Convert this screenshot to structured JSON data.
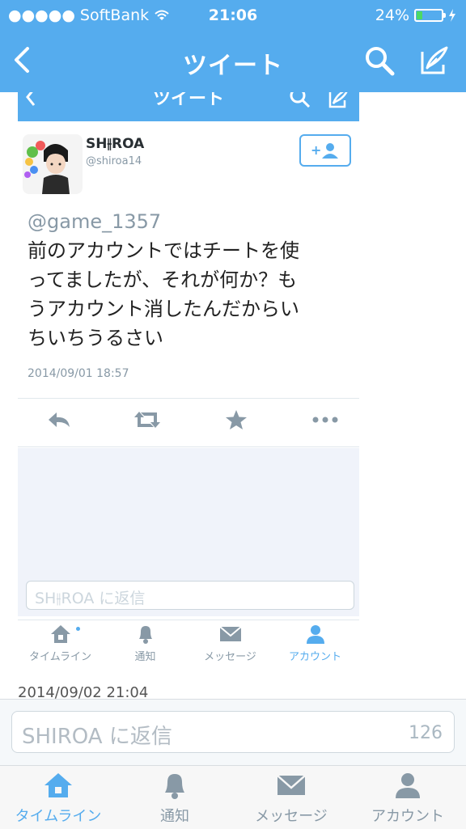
{
  "status_bar": {
    "carrier": "●●●●● SoftBank",
    "time": "21:06",
    "battery": "24%",
    "battery_level": 0.24,
    "icons": [
      "wifi-icon",
      "battery-icon",
      "charging-icon"
    ]
  },
  "nav": {
    "title": "ツイート",
    "icons": [
      "back-chevron-icon",
      "search-icon",
      "compose-icon"
    ]
  },
  "embedded_screenshot": {
    "nav_title": "ツイート",
    "tweet": {
      "display_name": "SH⫲ROA",
      "handle": "@shiroa14",
      "mention": "@game_1357",
      "lines": [
        "前のアカウントではチートを使",
        "ってましたが、それが何か？も",
        "うアカウント消したんだからい",
        "ちいちうるさい"
      ],
      "timestamp": "2014/09/01 18:57"
    },
    "actions": [
      "reply-icon",
      "retweet-icon",
      "favorite-icon",
      "more-icon"
    ],
    "reply_placeholder": "SH⫲ROA に返信",
    "tabs": [
      {
        "label": "タイムライン",
        "icon": "home-icon"
      },
      {
        "label": "通知",
        "icon": "bell-icon"
      },
      {
        "label": "メッセージ",
        "icon": "envelope-icon"
      },
      {
        "label": "アカウント",
        "icon": "person-icon"
      }
    ],
    "bottom_date": "2014/09/02 21:04"
  },
  "reply": {
    "placeholder": "SHIROA に返信",
    "char_count": "126"
  },
  "tabbar": {
    "items": [
      {
        "label": "タイムライン",
        "icon": "home-icon",
        "active": true
      },
      {
        "label": "通知",
        "icon": "bell-icon",
        "active": false
      },
      {
        "label": "メッセージ",
        "icon": "envelope-icon",
        "active": false
      },
      {
        "label": "アカウント",
        "icon": "person-icon",
        "active": false
      }
    ]
  },
  "colors": {
    "accent": "#55acee",
    "inactive": "#8899a6",
    "battery": "#4cd964"
  }
}
